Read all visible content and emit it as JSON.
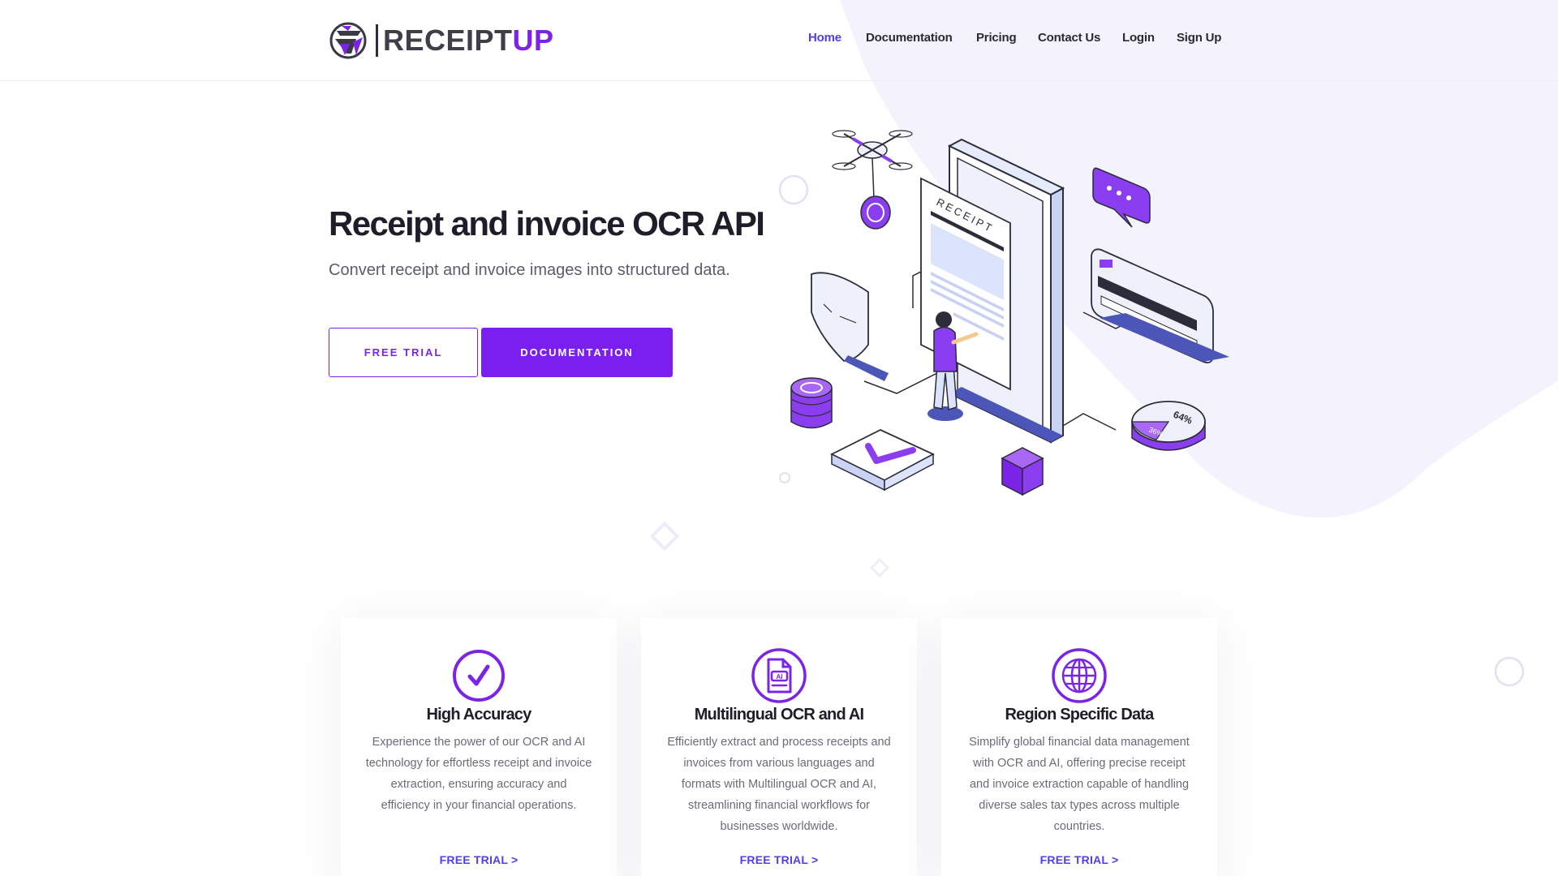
{
  "colors": {
    "accent": "#7b24e8",
    "nav_active": "#4f3df0",
    "blob": "#f4f2fd",
    "text_dark": "#1e1e2a",
    "text_muted": "#6b6b78"
  },
  "brand": {
    "name_part1": "RECEIPT",
    "name_part2": "UP",
    "icon": "receiptup-logo-icon"
  },
  "nav": {
    "items": [
      {
        "label": "Home",
        "active": true
      },
      {
        "label": "Documentation",
        "active": false
      },
      {
        "label": "Pricing",
        "active": false
      },
      {
        "label": "Contact Us",
        "active": false
      },
      {
        "label": "Login",
        "active": false
      },
      {
        "label": "Sign Up",
        "active": false
      }
    ]
  },
  "hero": {
    "title": "Receipt and invoice OCR API",
    "subtitle": "Convert receipt and invoice images into structured data.",
    "btn_free_trial": "FREE TRIAL",
    "btn_documentation": "DOCUMENTATION",
    "illustration": {
      "receipt_label": "RECEIPT",
      "chart_label_1": "64%",
      "chart_label_2": "36%"
    }
  },
  "features": [
    {
      "icon": "checkmark-circle-icon",
      "title": "High Accuracy",
      "text": "Experience the power of our OCR and AI technology for effortless receipt and invoice extraction, ensuring accuracy and efficiency in your financial operations.",
      "link": "FREE TRIAL >"
    },
    {
      "icon": "ai-document-icon",
      "title": "Multilingual OCR and AI",
      "text": "Efficiently extract and process receipts and invoices from various languages and formats with Multilingual OCR and AI, streamlining financial workflows for businesses worldwide.",
      "link": "FREE TRIAL >"
    },
    {
      "icon": "globe-icon",
      "title": "Region Specific Data",
      "text": "Simplify global financial data management with OCR and AI, offering precise receipt and invoice extraction capable of handling diverse sales tax types across multiple countries.",
      "link": "FREE TRIAL >"
    }
  ]
}
